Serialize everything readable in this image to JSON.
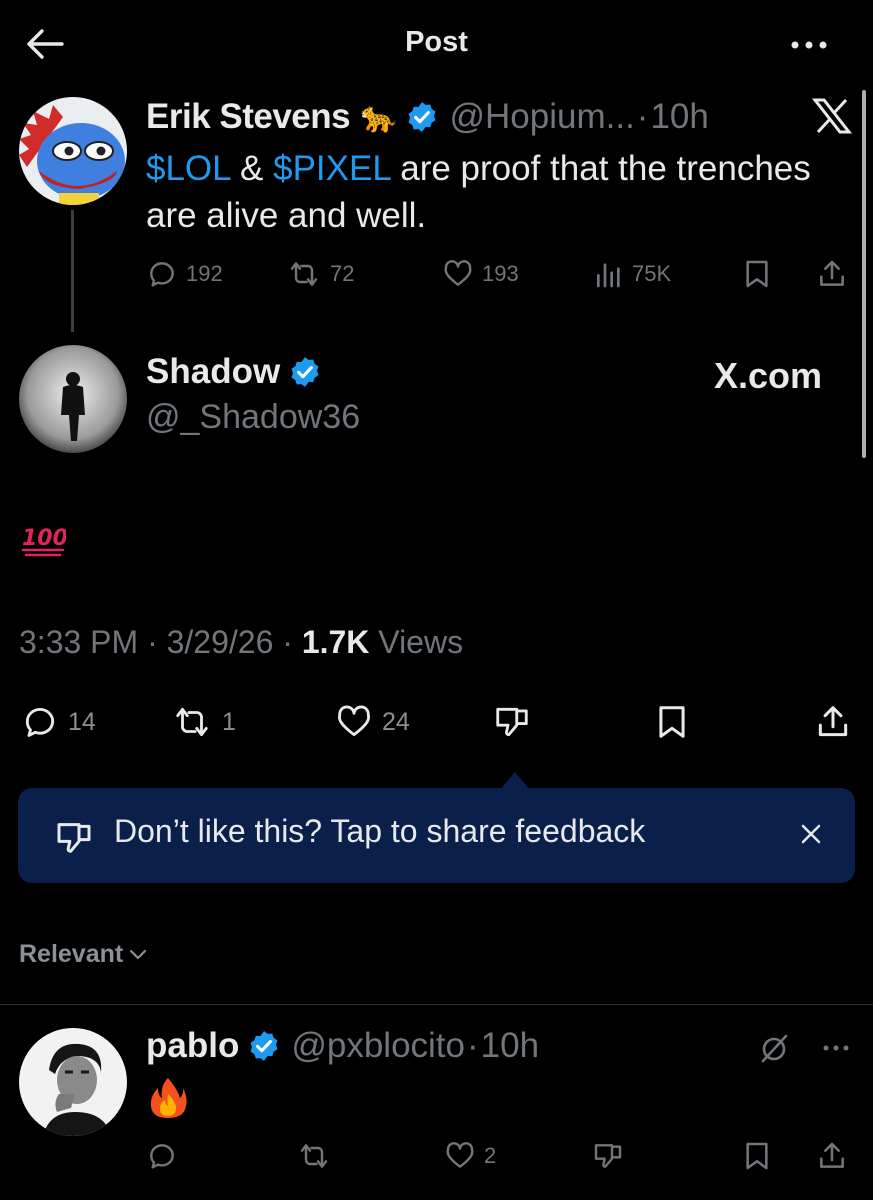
{
  "header": {
    "title": "Post"
  },
  "quoted": {
    "name": "Erik Stevens",
    "emoji": "🐆",
    "handle": "@Hopium...",
    "time_sep": "·",
    "time": "10h",
    "text_parts": [
      "$LOL",
      " & ",
      "$PIXEL",
      " are proof that the trenches are alive and well."
    ],
    "replies": "192",
    "reposts": "72",
    "likes": "193",
    "views": "75K"
  },
  "author": {
    "name": "Shadow",
    "handle": "@_Shadow36",
    "source": "X.com"
  },
  "post": {
    "time": "3:33 PM",
    "date": "3/29/26",
    "views_count": "1.7K",
    "views_label": "Views",
    "sep": "·",
    "replies": "14",
    "reposts": "1",
    "likes": "24"
  },
  "feedback_banner": {
    "text": "Don’t like this? Tap to share feedback"
  },
  "sort": {
    "label": "Relevant"
  },
  "reply": {
    "name": "pablo",
    "handle": "@pxblocito",
    "time_sep": "·",
    "time": "10h",
    "likes": "2"
  },
  "colors": {
    "accent": "#1d9bf0",
    "banner": "#0b1f4b",
    "muted": "#71767b"
  },
  "icons": [
    "back-arrow-icon",
    "more-icon",
    "verified-icon",
    "x-logo-icon",
    "reply-icon",
    "repost-icon",
    "like-icon",
    "views-icon",
    "bookmark-icon",
    "share-icon",
    "dislike-icon",
    "close-icon",
    "chevron-down-icon",
    "grok-icon",
    "hundred-icon",
    "fire-icon"
  ]
}
